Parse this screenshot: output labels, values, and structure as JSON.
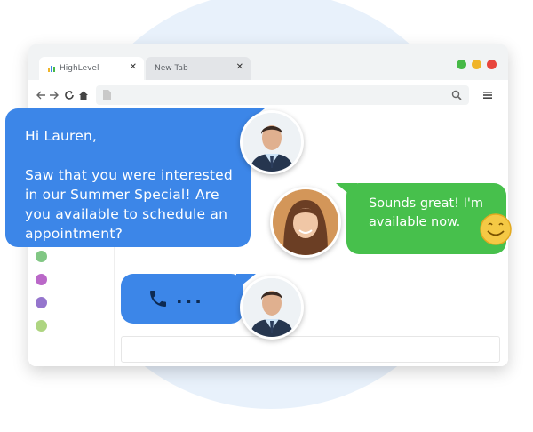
{
  "browser": {
    "tabs": [
      {
        "label": "HighLevel",
        "close": "✕"
      },
      {
        "label": "New Tab",
        "close": "✕"
      }
    ],
    "window_dots": [
      "#46b946",
      "#f0b429",
      "#e8453c"
    ]
  },
  "chat": {
    "incoming_message": "Hi Lauren,\n\nSaw that you were interested in our Summer Special! Are you available to schedule an appointment?",
    "reply_message": "Sounds great! I'm available now.",
    "call_dots": "..."
  },
  "emoji": "smiling-face",
  "colors": {
    "blue_bubble": "#3c86e8",
    "green_bubble": "#47c04c",
    "background_circle": "#e8f1fb"
  }
}
